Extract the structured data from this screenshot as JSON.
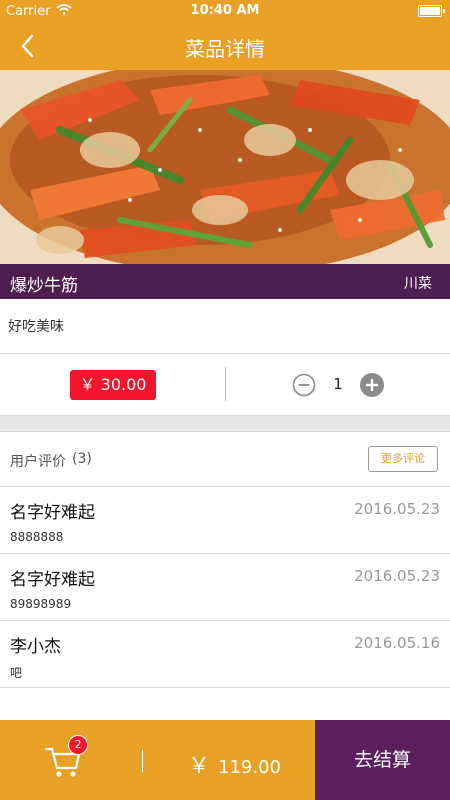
{
  "status_bar": {
    "carrier": "Carrier",
    "time": "10:40 AM"
  },
  "nav": {
    "title": "菜品详情",
    "back_icon": "chevron-left-icon"
  },
  "dish": {
    "name": "爆炒牛筋",
    "cuisine": "川菜",
    "description": "好吃美味"
  },
  "price": {
    "label": "￥ 30.00"
  },
  "quantity": {
    "value": "1"
  },
  "reviews": {
    "title": "用户评价",
    "count": "(3)",
    "more_label": "更多评论",
    "items": [
      {
        "name": "名字好难起",
        "date": "2016.05.23",
        "text": "8888888"
      },
      {
        "name": "名字好难起",
        "date": "2016.05.23",
        "text": "89898989"
      },
      {
        "name": "李小杰",
        "date": "2016.05.16",
        "text": "吧"
      }
    ]
  },
  "bottom": {
    "cart_badge": "2",
    "currency": "￥",
    "total": "119.00",
    "checkout_label": "去结算"
  },
  "colors": {
    "accent": "#E8A125",
    "purple": "#4F1E50",
    "price_red": "#F2152C"
  }
}
